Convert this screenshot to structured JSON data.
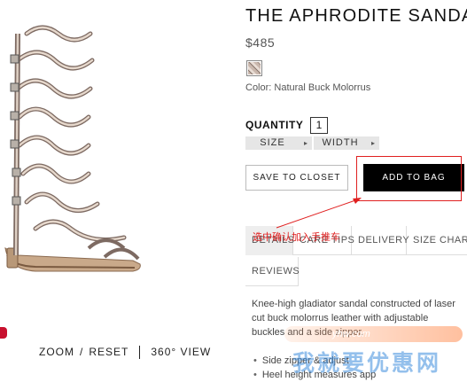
{
  "product": {
    "title": "THE APHRODITE SANDAL",
    "price": "$485",
    "color_label": "Color: Natural Buck Molorrus",
    "swatch_icon": "snakeskin-swatch"
  },
  "quantity": {
    "label": "QUANTITY",
    "value": "1"
  },
  "selectors": [
    {
      "label": "SIZE",
      "arrow": "▸"
    },
    {
      "label": "WIDTH",
      "arrow": "▸"
    }
  ],
  "buttons": {
    "save_closet": "SAVE TO CLOSET",
    "add_to_bag": "ADD TO BAG"
  },
  "annotation": {
    "text": "选中确认加入手推车",
    "color": "#e02020"
  },
  "tabs": {
    "details": "DETAILS",
    "care": "CARE TIPS",
    "delivery": "DELIVERY",
    "size_chart": "SIZE CHART",
    "reviews": "REVIEWS"
  },
  "description": {
    "line1": "Knee-high gladiator sandal constructed of laser",
    "line2": "cut buck molorrus leather with adjustable",
    "line3": "buckles and a side zipper.",
    "bullets": [
      "Side zipper & adjust",
      "Heel height measures app"
    ]
  },
  "image_controls": {
    "zoom": "ZOOM",
    "slash": "/",
    "reset": "RESET",
    "view360": "360° VIEW"
  },
  "watermark": {
    "url": "yhw.com",
    "brand": "我就要优惠网"
  }
}
